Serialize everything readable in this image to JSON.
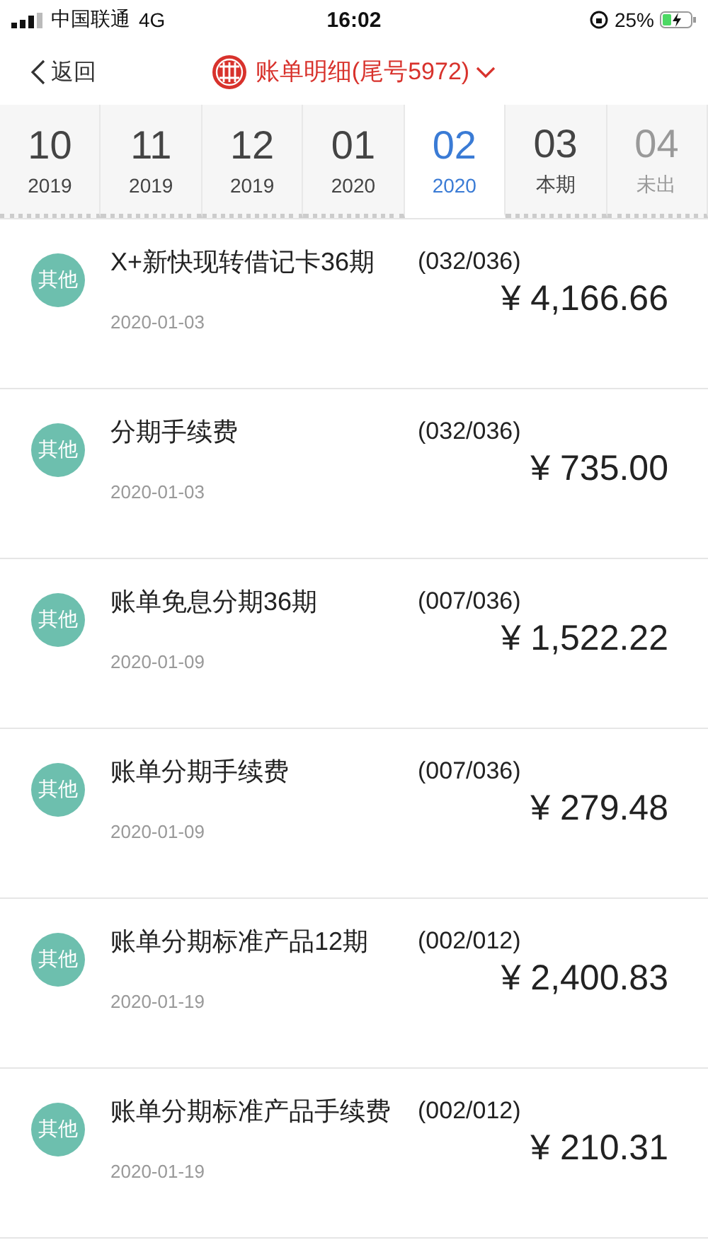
{
  "status_bar": {
    "carrier": "中国联通",
    "network": "4G",
    "time": "16:02",
    "battery": "25%"
  },
  "nav": {
    "back": "返回",
    "title": "账单明细(尾号5972)"
  },
  "tabs": [
    {
      "month": "10",
      "sub": "2019",
      "selected": false,
      "disabled": false
    },
    {
      "month": "11",
      "sub": "2019",
      "selected": false,
      "disabled": false
    },
    {
      "month": "12",
      "sub": "2019",
      "selected": false,
      "disabled": false
    },
    {
      "month": "01",
      "sub": "2020",
      "selected": false,
      "disabled": false
    },
    {
      "month": "02",
      "sub": "2020",
      "selected": true,
      "disabled": false
    },
    {
      "month": "03",
      "sub": "本期",
      "selected": false,
      "disabled": false
    },
    {
      "month": "04",
      "sub": "未出",
      "selected": false,
      "disabled": true
    }
  ],
  "transactions": [
    {
      "category": "其他",
      "title": "X+新快现转借记卡36期",
      "term": "(032/036)",
      "date": "2020-01-03",
      "amount": "¥ 4,166.66"
    },
    {
      "category": "其他",
      "title": "分期手续费",
      "term": "(032/036)",
      "date": "2020-01-03",
      "amount": "¥ 735.00"
    },
    {
      "category": "其他",
      "title": "账单免息分期36期",
      "term": "(007/036)",
      "date": "2020-01-09",
      "amount": "¥ 1,522.22"
    },
    {
      "category": "其他",
      "title": "账单分期手续费",
      "term": "(007/036)",
      "date": "2020-01-09",
      "amount": "¥ 279.48"
    },
    {
      "category": "其他",
      "title": "账单分期标准产品12期",
      "term": "(002/012)",
      "date": "2020-01-19",
      "amount": "¥ 2,400.83"
    },
    {
      "category": "其他",
      "title": "账单分期标准产品手续费",
      "term": "(002/012)",
      "date": "2020-01-19",
      "amount": "¥ 210.31"
    }
  ]
}
